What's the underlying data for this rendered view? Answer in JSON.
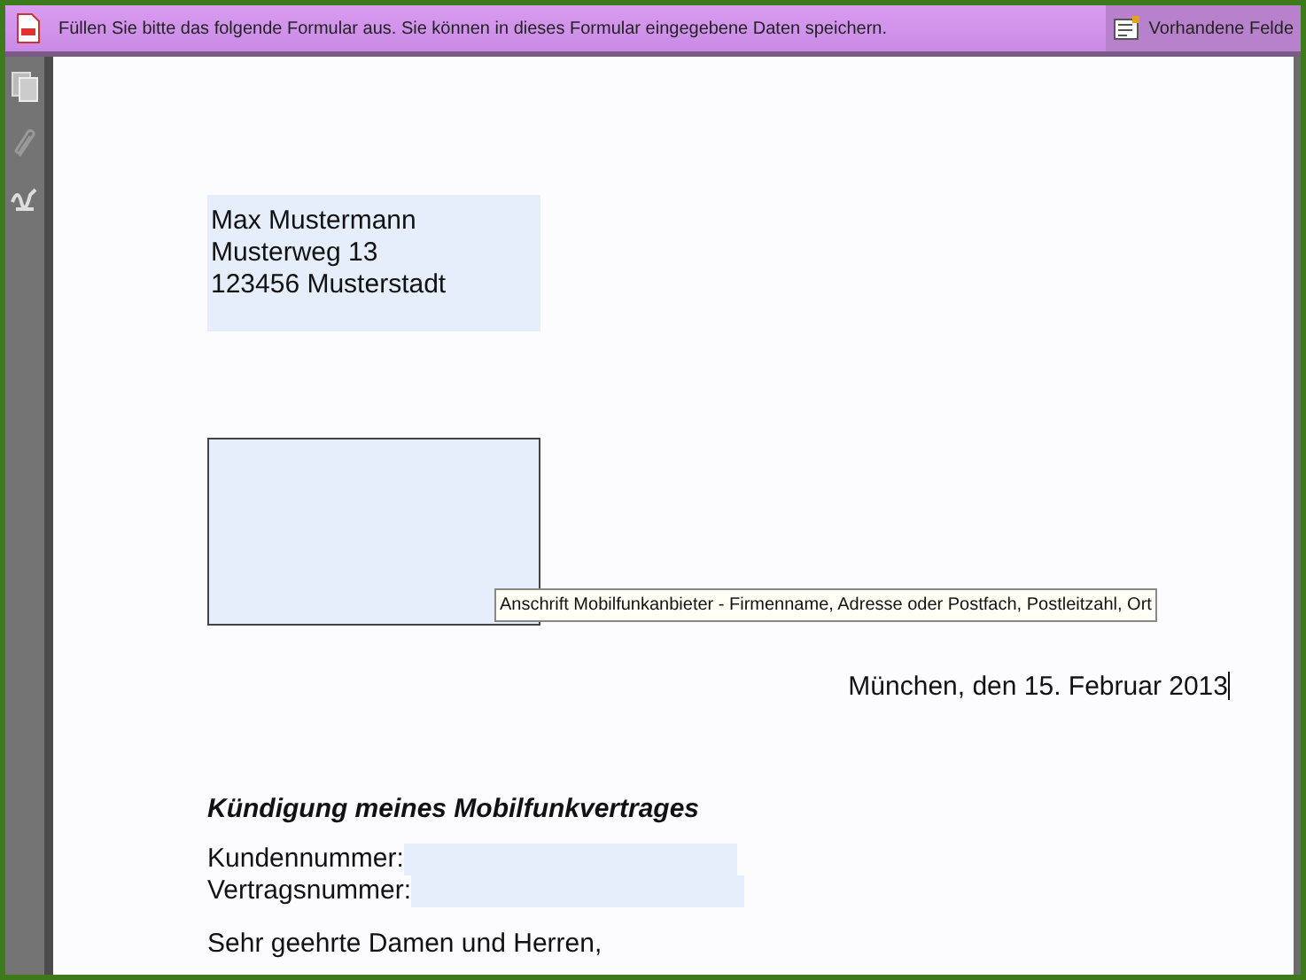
{
  "infobar": {
    "message": "Füllen Sie bitte das folgende Formular aus. Sie können in dieses Formular eingegebene Daten speichern.",
    "button": "Vorhandene Felde"
  },
  "sender_field": {
    "lines": [
      "Max Mustermann",
      "Musterweg 13",
      "123456 Musterstadt"
    ]
  },
  "recipient_field": {
    "tooltip": "Anschrift Mobilfunkanbieter - Firmenname, Adresse oder Postfach, Postleitzahl, Ort"
  },
  "date": "München, den 15. Februar 2013",
  "subject": "Kündigung meines Mobilfunkvertrages",
  "fields": [
    {
      "label": "Kundennummer:"
    },
    {
      "label": "Vertragsnummer:"
    }
  ],
  "salutation": "Sehr geehrte Damen und Herren,"
}
